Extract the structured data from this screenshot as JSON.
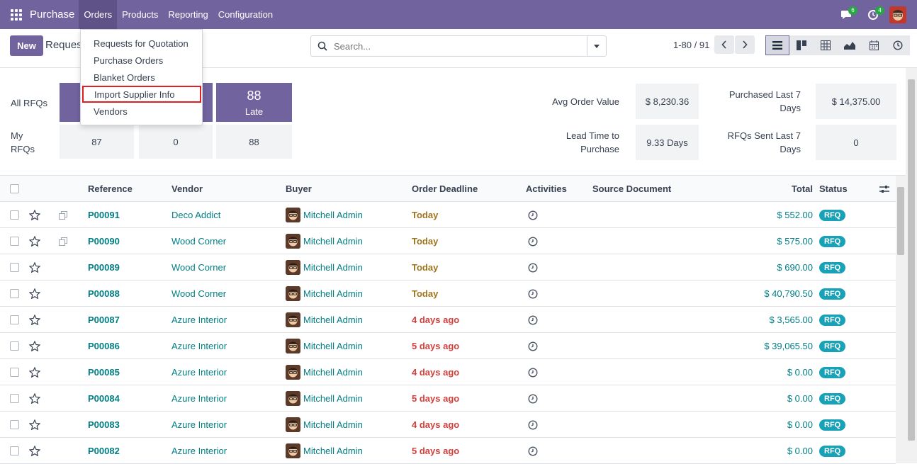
{
  "navbar": {
    "app_name": "Purchase",
    "menus": [
      "Orders",
      "Products",
      "Reporting",
      "Configuration"
    ],
    "messages_count": "6",
    "activities_count": "4",
    "accent": "#71639e"
  },
  "control": {
    "new_label": "New",
    "title": "Reques",
    "search_placeholder": "Search...",
    "pager": "1-80 / 91"
  },
  "dropdown": {
    "items": [
      "Requests for Quotation",
      "Purchase Orders",
      "Blanket Orders",
      "Import Supplier Info",
      "Vendors"
    ],
    "highlighted": "Import Supplier Info"
  },
  "dashboard": {
    "all_rfqs_label": "All RFQs",
    "my_rfqs_label": "My RFQs",
    "late_tile": {
      "value": "88",
      "label": "Late"
    },
    "my_values": [
      "87",
      "0",
      "88"
    ],
    "avg_order_label": "Avg Order Value",
    "avg_order_value": "$ 8,230.36",
    "lead_time_label": "Lead Time to Purchase",
    "lead_time_value": "9.33 Days",
    "purchased_label": "Purchased Last 7 Days",
    "purchased_value": "$ 14,375.00",
    "rfqs_sent_label": "RFQs Sent Last 7 Days",
    "rfqs_sent_value": "0"
  },
  "table": {
    "headers": {
      "reference": "Reference",
      "vendor": "Vendor",
      "buyer": "Buyer",
      "deadline": "Order Deadline",
      "activities": "Activities",
      "source": "Source Document",
      "total": "Total",
      "status": "Status"
    },
    "rows": [
      {
        "ref": "P00091",
        "vendor": "Deco Addict",
        "buyer": "Mitchell Admin",
        "deadline": "Today",
        "late": false,
        "total": "$ 552.00",
        "status": "RFQ",
        "copy": true
      },
      {
        "ref": "P00090",
        "vendor": "Wood Corner",
        "buyer": "Mitchell Admin",
        "deadline": "Today",
        "late": false,
        "total": "$ 575.00",
        "status": "RFQ",
        "copy": true
      },
      {
        "ref": "P00089",
        "vendor": "Wood Corner",
        "buyer": "Mitchell Admin",
        "deadline": "Today",
        "late": false,
        "total": "$ 690.00",
        "status": "RFQ",
        "copy": false
      },
      {
        "ref": "P00088",
        "vendor": "Wood Corner",
        "buyer": "Mitchell Admin",
        "deadline": "Today",
        "late": false,
        "total": "$ 40,790.50",
        "status": "RFQ",
        "copy": false
      },
      {
        "ref": "P00087",
        "vendor": "Azure Interior",
        "buyer": "Mitchell Admin",
        "deadline": "4 days ago",
        "late": true,
        "total": "$ 3,565.00",
        "status": "RFQ",
        "copy": false
      },
      {
        "ref": "P00086",
        "vendor": "Azure Interior",
        "buyer": "Mitchell Admin",
        "deadline": "5 days ago",
        "late": true,
        "total": "$ 39,065.50",
        "status": "RFQ",
        "copy": false
      },
      {
        "ref": "P00085",
        "vendor": "Azure Interior",
        "buyer": "Mitchell Admin",
        "deadline": "4 days ago",
        "late": true,
        "total": "$ 0.00",
        "status": "RFQ",
        "copy": false
      },
      {
        "ref": "P00084",
        "vendor": "Azure Interior",
        "buyer": "Mitchell Admin",
        "deadline": "5 days ago",
        "late": true,
        "total": "$ 0.00",
        "status": "RFQ",
        "copy": false
      },
      {
        "ref": "P00083",
        "vendor": "Azure Interior",
        "buyer": "Mitchell Admin",
        "deadline": "4 days ago",
        "late": true,
        "total": "$ 0.00",
        "status": "RFQ",
        "copy": false
      },
      {
        "ref": "P00082",
        "vendor": "Azure Interior",
        "buyer": "Mitchell Admin",
        "deadline": "5 days ago",
        "late": true,
        "total": "$ 0.00",
        "status": "RFQ",
        "copy": false
      }
    ]
  }
}
